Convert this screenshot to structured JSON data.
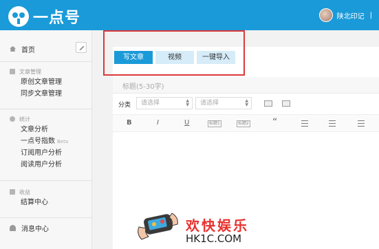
{
  "header": {
    "brand": "一点号",
    "user_name": "陕北印记",
    "user_sep": "|"
  },
  "sidebar": {
    "home": "首页",
    "groups": [
      {
        "title": "文章管理",
        "items": [
          "原创文章管理",
          "同步文章管理"
        ]
      },
      {
        "title": "统计",
        "items": [
          "文章分析",
          "一点号指数",
          "订阅用户分析",
          "阅读用户分析"
        ],
        "beta": "Beta"
      },
      {
        "title": "收益",
        "items": [
          "结算中心"
        ]
      }
    ],
    "messages": "消息中心"
  },
  "editor": {
    "tabs": [
      "写文章",
      "视频",
      "一键导入"
    ],
    "title_placeholder": "标题(5-30字)",
    "category_label": "分类",
    "select_placeholder_1": "请选择",
    "select_placeholder_2": "请选择",
    "toolbar": {
      "bold": "B",
      "italic": "I",
      "underline": "U",
      "h1": "标题1",
      "h2": "标题2",
      "quote": "“"
    }
  },
  "watermark": {
    "title": "欢快娱乐",
    "url": "HK1C.COM"
  },
  "colors": {
    "brand": "#1a9ad8",
    "highlight": "#d9383a"
  }
}
